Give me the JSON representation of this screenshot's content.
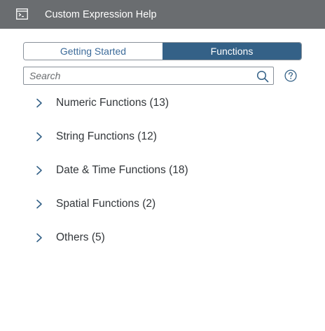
{
  "window": {
    "title": "Custom Expression Help",
    "title_icon": "console-window-icon"
  },
  "tabs": [
    {
      "label": "Getting Started",
      "selected": false
    },
    {
      "label": "Functions",
      "selected": true
    }
  ],
  "search": {
    "placeholder": "Search",
    "value": "",
    "icon": "search-icon"
  },
  "help": {
    "icon": "question-circle-icon"
  },
  "categories": [
    {
      "label": "Numeric Functions (13)",
      "expanded": false
    },
    {
      "label": "String Functions (12)",
      "expanded": false
    },
    {
      "label": "Date & Time Functions (18)",
      "expanded": false
    },
    {
      "label": "Spatial Functions (2)",
      "expanded": false
    },
    {
      "label": "Others (5)",
      "expanded": false
    }
  ],
  "colors": {
    "titlebar": "#6a6d70",
    "accent": "#346187",
    "link": "#3c6b9a",
    "text": "#32363a"
  }
}
